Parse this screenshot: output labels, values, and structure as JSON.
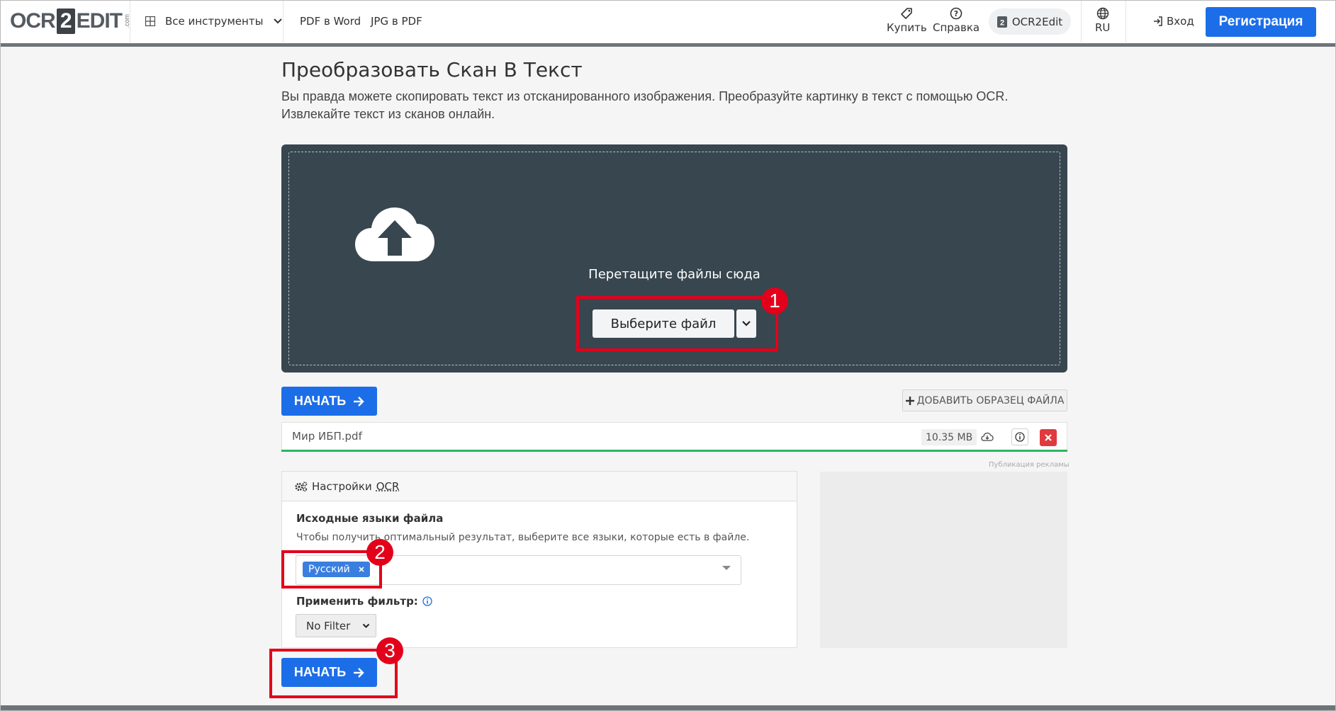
{
  "header": {
    "logo": {
      "prefix": "OCR",
      "two": "2",
      "suffix": "EDIT",
      "dotcom": ".com"
    },
    "tools_label": "Все инструменты",
    "nav": [
      "PDF в Word",
      "JPG в PDF"
    ],
    "buy": "Купить",
    "help": "Справка",
    "brand_pill": "OCR2Edit",
    "lang": "RU",
    "login": "Вход",
    "register": "Регистрация"
  },
  "main": {
    "title": "Преобразовать Скан В Текст",
    "description": "Вы правда можете скопировать текст из отсканированного изображения. Преобразуйте картинку в текст с помощью OCR. Извлекайте текст из сканов онлайн.",
    "dropzone": {
      "text": "Перетащите файлы сюда",
      "choose_file": "Выберите файл"
    },
    "start_label": "НАЧАТЬ",
    "add_sample": "ДОБАВИТЬ ОБРАЗЕЦ ФАЙЛА",
    "file": {
      "name": "Мир ИБП.pdf",
      "size": "10.35 MB",
      "progress": 1.0
    },
    "ad_label": "Публикация рекламы",
    "settings": {
      "title_prefix": "Настройки",
      "title_ocr": "OCR",
      "lang_title": "Исходные языки файла",
      "lang_hint": "Чтобы получить оптимальный результат, выберите все языки, которые есть в файле.",
      "selected_language": "Русский",
      "filter_label": "Применить фильтр:",
      "filter_value": "No Filter"
    }
  },
  "annotations": [
    "1",
    "2",
    "3"
  ],
  "colors": {
    "primary": "#1c6ee8",
    "dropzone": "#37464f",
    "annotation": "#e3001b",
    "progress": "#2cb560",
    "delete": "#e0393e"
  }
}
